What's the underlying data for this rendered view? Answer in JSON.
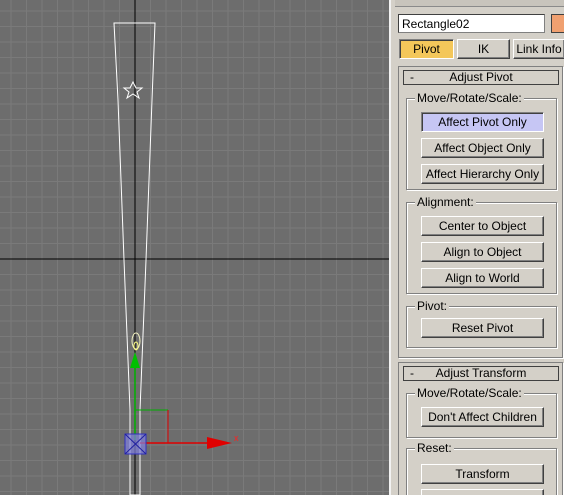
{
  "object": {
    "name": "Rectangle02",
    "color": "#f0a070"
  },
  "tabs": [
    {
      "label": "Pivot",
      "active": true
    },
    {
      "label": "IK",
      "active": false
    },
    {
      "label": "Link Info",
      "active": false
    }
  ],
  "adjust_pivot": {
    "title": "Adjust Pivot",
    "collapse_symbol": "-",
    "move_group": {
      "label": "Move/Rotate/Scale:",
      "buttons": [
        "Affect Pivot Only",
        "Affect Object Only",
        "Affect Hierarchy Only"
      ],
      "active": "Affect Pivot Only"
    },
    "alignment_group": {
      "label": "Alignment:",
      "buttons": [
        "Center to Object",
        "Align to Object",
        "Align to World"
      ]
    },
    "pivot_group": {
      "label": "Pivot:",
      "buttons": [
        "Reset Pivot"
      ]
    }
  },
  "adjust_transform": {
    "title": "Adjust Transform",
    "collapse_symbol": "-",
    "move_group": {
      "label": "Move/Rotate/Scale:",
      "buttons": [
        "Don't Affect Children"
      ]
    },
    "reset_group": {
      "label": "Reset:",
      "buttons": [
        "Transform"
      ]
    }
  },
  "gizmo": {
    "x_axis_label": "x"
  },
  "colors": {
    "viewport_bg": "#6d6d6d",
    "grid": "#7a7a7a",
    "grid_major": "#000000",
    "object_outline": "#ffffff",
    "x_axis": "#e00000",
    "y_axis": "#00b000",
    "pivot_box": "#5a5af0",
    "active_tab": "#f4c75a",
    "active_button": "#c6c6f4"
  }
}
